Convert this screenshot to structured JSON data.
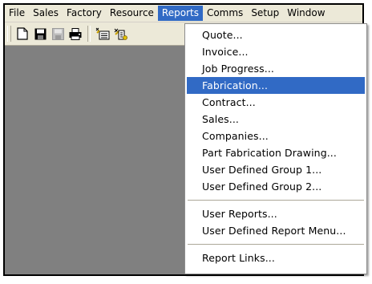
{
  "menubar": {
    "items": [
      {
        "label": "File"
      },
      {
        "label": "Sales"
      },
      {
        "label": "Factory"
      },
      {
        "label": "Resource"
      },
      {
        "label": "Reports"
      },
      {
        "label": "Comms"
      },
      {
        "label": "Setup"
      },
      {
        "label": "Window"
      }
    ],
    "active": "Reports"
  },
  "toolbar": {
    "buttons": [
      "new-document-icon",
      "save-icon",
      "save-all-icon",
      "print-icon",
      "toolbar-icon-5",
      "toolbar-icon-6"
    ]
  },
  "reports_menu": {
    "groups": [
      [
        "Quote...",
        "Invoice...",
        "Job Progress...",
        "Fabrication...",
        "Contract...",
        "Sales...",
        "Companies...",
        "Part Fabrication Drawing...",
        "User Defined Group 1...",
        "User Defined Group 2..."
      ],
      [
        "User Reports...",
        "User Defined Report Menu..."
      ],
      [
        "Report Links..."
      ]
    ],
    "highlighted": "Fabrication..."
  },
  "colors": {
    "menu_highlight": "#316ac5",
    "workspace": "#808080",
    "chrome": "#ece9d8"
  }
}
